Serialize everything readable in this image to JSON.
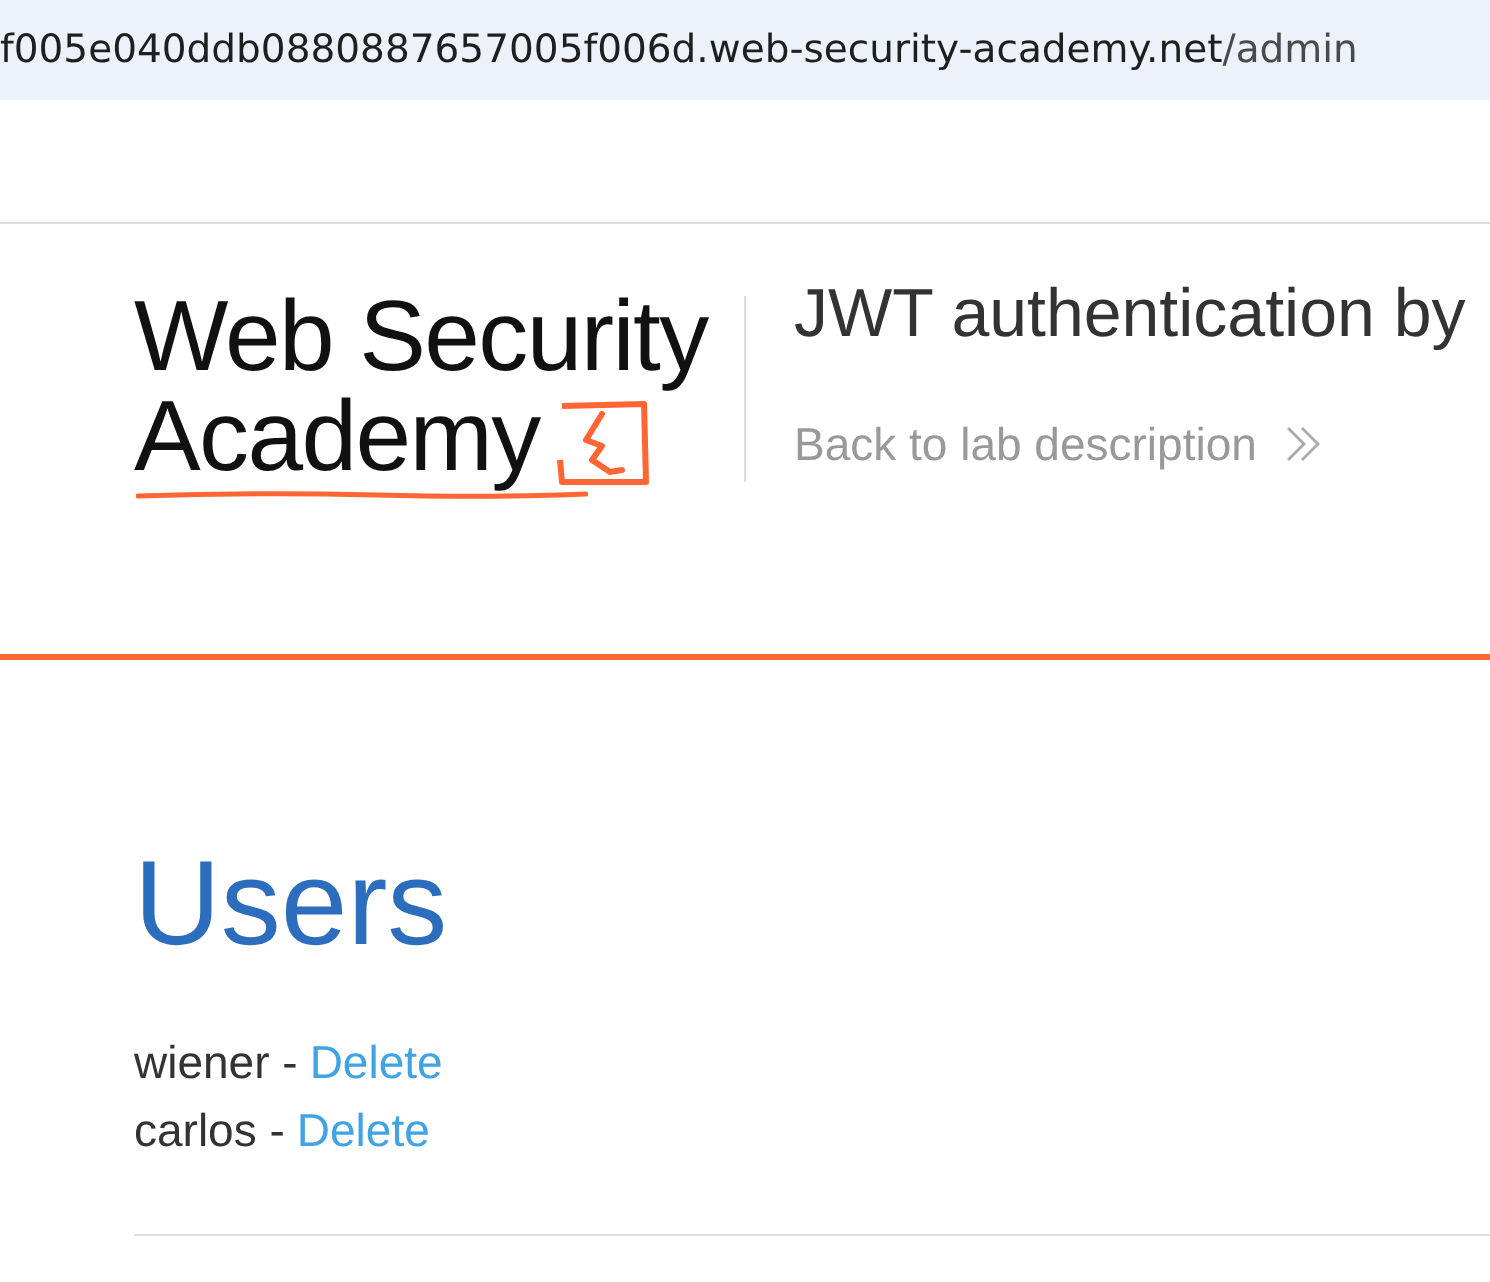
{
  "browser": {
    "url_host": "f005e040ddb0880887657005f006d.web-security-academy.net",
    "url_path": "/admin"
  },
  "header": {
    "logo_lines": [
      "Web Security",
      "Academy"
    ],
    "title": "JWT authentication by",
    "back_link": "Back to lab description"
  },
  "main": {
    "heading": "Users",
    "users": [
      {
        "name": "wiener",
        "separator": "-",
        "action": "Delete"
      },
      {
        "name": "carlos",
        "separator": "-",
        "action": "Delete"
      }
    ]
  }
}
